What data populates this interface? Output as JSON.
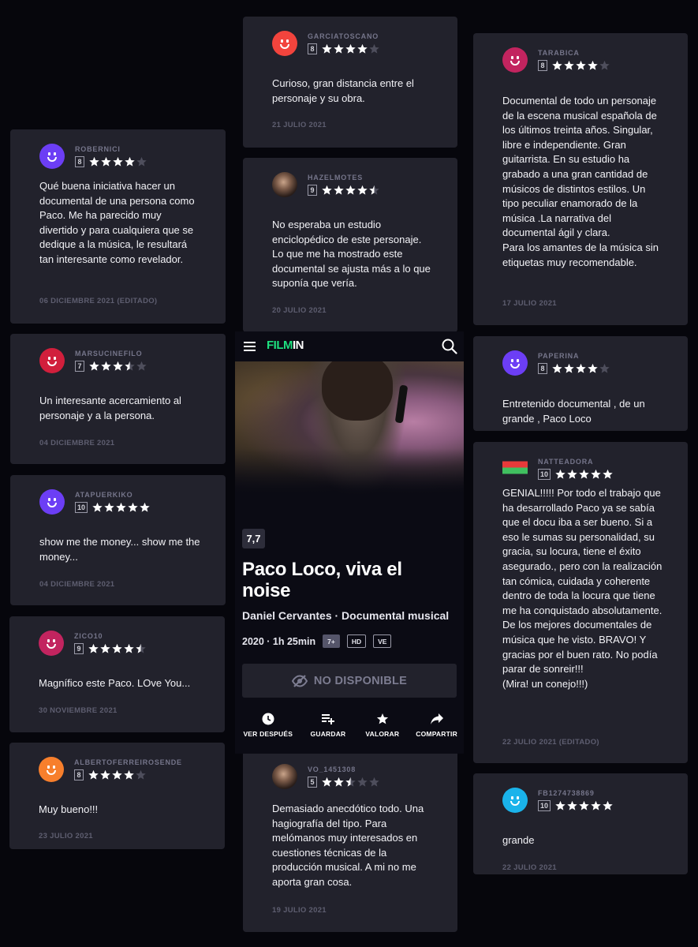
{
  "colors": {
    "background": "#06060c",
    "card": "#22222c",
    "star_on": "#ffffff",
    "star_off": "#4e4e5c",
    "brand": "#1ee07f"
  },
  "reviews": [
    {
      "user": "ROBERNICI",
      "score": "8",
      "stars": 4,
      "avatar": "#6c3ef5",
      "text": "Qué buena iniciativa hacer un documental de una persona como Paco. Me ha parecido muy divertido y para cualquiera que se dedique a la música, le resultará tan interesante como revelador.",
      "date": "06 DICIEMBRE 2021 (EDITADO)"
    },
    {
      "user": "MARSUCINEFILO",
      "score": "7",
      "stars": 3.5,
      "avatar": "#d11f3c",
      "text": "Un interesante acercamiento al personaje y a la persona.",
      "date": "04 DICIEMBRE 2021"
    },
    {
      "user": "ATAPUERKIKO",
      "score": "10",
      "stars": 5,
      "avatar": "#6c3ef5",
      "text": "show me the money... show me the money...",
      "date": "04 DICIEMBRE 2021"
    },
    {
      "user": "ZICO10",
      "score": "9",
      "stars": 4.5,
      "avatar": "#c2245f",
      "text": "Magnífico este Paco. LOve You...",
      "date": "30 NOVIEMBRE 2021"
    },
    {
      "user": "ALBERTOFERREIROSENDE",
      "score": "8",
      "stars": 4,
      "avatar": "#f77f2c",
      "text": "Muy bueno!!!",
      "date": "23 JULIO 2021"
    },
    {
      "user": "GARCIATOSCANO",
      "score": "8",
      "stars": 4,
      "avatar": "#f2443d",
      "text": "Curioso, gran distancia entre el personaje y su obra.",
      "date": "21 JULIO 2021"
    },
    {
      "user": "HAZELMOTES",
      "score": "9",
      "stars": 4.5,
      "avatar": "photo",
      "text": "No esperaba un estudio enciclopédico de este personaje. Lo que me ha mostrado este documental se ajusta más a lo que suponía que vería.",
      "date": "20 JULIO 2021"
    },
    {
      "user": "VO_1451308",
      "score": "5",
      "stars": 2.5,
      "avatar": "photo",
      "text": "Demasiado anecdótico todo. Una hagiografía del tipo. Para melómanos muy interesados en cuestiones técnicas de la producción musical. A mi no me aporta gran cosa.",
      "date": "19 JULIO 2021"
    },
    {
      "user": "TARABICA",
      "score": "8",
      "stars": 4,
      "avatar": "#c2245f",
      "text": "Documental de todo un personaje de la escena musical española de los últimos treinta años. Singular, libre e independiente. Gran guitarrista. En su estudio ha grabado a una gran cantidad de músicos de distintos estilos. Un tipo peculiar enamorado de la música .La narrativa del documental ágil y clara.\nPara los amantes de la música sin etiquetas muy recomendable.",
      "date": "17 JULIO 2021"
    },
    {
      "user": "PAPERINA",
      "score": "8",
      "stars": 4,
      "avatar": "#6c3ef5",
      "text": "Entretenido documental , de un grande , Paco Loco",
      "date": ""
    },
    {
      "user": "NATTEADORA",
      "score": "10",
      "stars": 5,
      "avatar": "pixel",
      "text": "GENIAL!!!!! Por todo el trabajo que ha desarrollado Paco ya se sabía que el docu iba a ser bueno. Si a eso le sumas su personalidad, su gracia, su locura, tiene el éxito asegurado., pero con la realización tan cómica, cuidada y coherente dentro de toda la locura que tiene me ha conquistado absolutamente. De los mejores documentales de música que he visto. BRAVO! Y gracias por el buen rato. No podía parar de sonreir!!!\n(Mira! un conejo!!!)",
      "date": "22 JULIO 2021 (EDITADO)"
    },
    {
      "user": "FB1274738869",
      "score": "10",
      "stars": 5,
      "avatar": "#1ab3ea",
      "text": "grande",
      "date": "22 JULIO 2021"
    }
  ],
  "film": {
    "logo_a": "FILM",
    "logo_b": "IN",
    "score": "7,7",
    "title": "Paco Loco, viva el noise",
    "meta": "Daniel Cervantes · Documental musical",
    "year_duration": "2020 · 1h 25min",
    "tags": [
      "7+",
      "HD",
      "VE"
    ],
    "unavailable": "NO DISPONIBLE",
    "actions": [
      {
        "icon": "clock-icon",
        "label": "VER DESPUÉS"
      },
      {
        "icon": "playlist-add-icon",
        "label": "GUARDAR"
      },
      {
        "icon": "star-icon",
        "label": "VALORAR"
      },
      {
        "icon": "share-icon",
        "label": "COMPARTIR"
      }
    ]
  }
}
